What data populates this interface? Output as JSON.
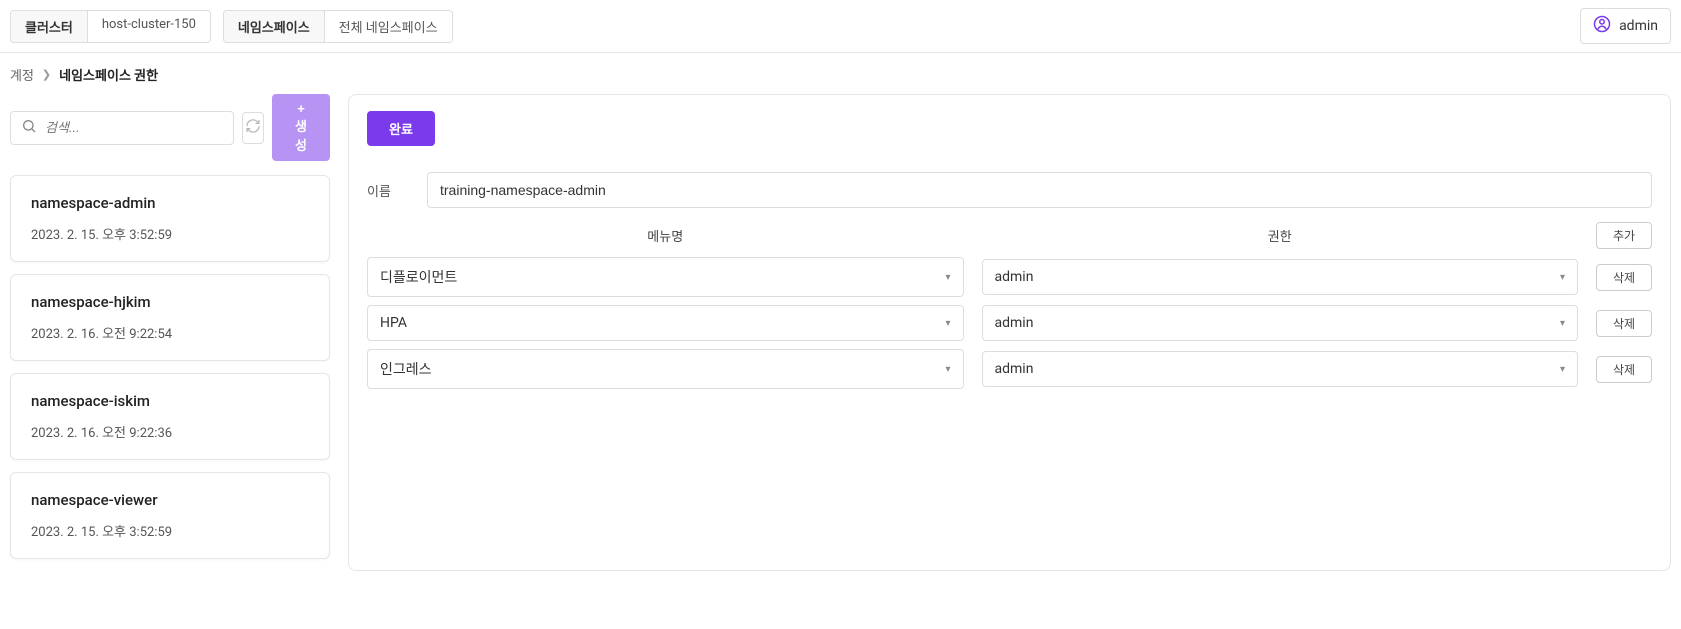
{
  "topbar": {
    "cluster_label": "클러스터",
    "cluster_value": "host-cluster-150",
    "namespace_label": "네임스페이스",
    "namespace_value": "전체 네임스페이스",
    "user": "admin"
  },
  "breadcrumb": {
    "parent": "계정",
    "current": "네임스페이스 권한"
  },
  "sidebar": {
    "search_placeholder": "검색...",
    "create_label": "+ 생성",
    "items": [
      {
        "name": "namespace-admin",
        "date": "2023. 2. 15. 오후 3:52:59"
      },
      {
        "name": "namespace-hjkim",
        "date": "2023. 2. 16. 오전 9:22:54"
      },
      {
        "name": "namespace-iskim",
        "date": "2023. 2. 16. 오전 9:22:36"
      },
      {
        "name": "namespace-viewer",
        "date": "2023. 2. 15. 오후 3:52:59"
      }
    ]
  },
  "content": {
    "done_label": "완료",
    "name_label": "이름",
    "name_value": "training-namespace-admin",
    "col_menu": "메뉴명",
    "col_perm": "권한",
    "add_label": "추가",
    "delete_label": "삭제",
    "rows": [
      {
        "menu": "디플로이먼트",
        "perm": "admin"
      },
      {
        "menu": "HPA",
        "perm": "admin"
      },
      {
        "menu": "인그레스",
        "perm": "admin"
      }
    ]
  }
}
